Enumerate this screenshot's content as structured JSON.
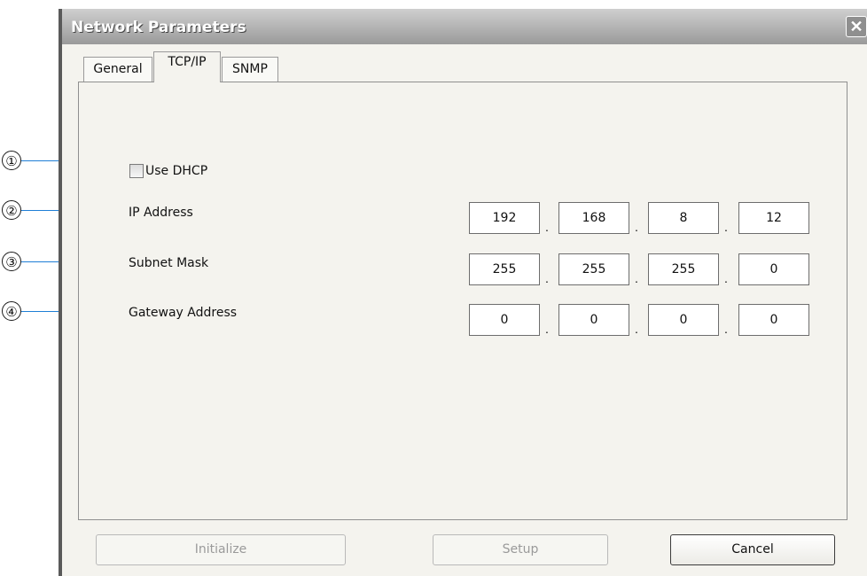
{
  "window": {
    "title": "Network Parameters",
    "close_glyph": "✕"
  },
  "tabs": [
    {
      "label": "General",
      "active": false
    },
    {
      "label": "TCP/IP",
      "active": true
    },
    {
      "label": "SNMP",
      "active": false
    }
  ],
  "callouts": [
    "①",
    "②",
    "③",
    "④"
  ],
  "tcpip": {
    "dhcp": {
      "label": "Use DHCP",
      "checked": false
    },
    "ip": {
      "label": "IP Address",
      "octets": [
        "192",
        "168",
        "8",
        "12"
      ]
    },
    "subnet": {
      "label": "Subnet Mask",
      "octets": [
        "255",
        "255",
        "255",
        "0"
      ]
    },
    "gateway": {
      "label": "Gateway Address",
      "octets": [
        "0",
        "0",
        "0",
        "0"
      ]
    }
  },
  "buttons": {
    "initialize": {
      "label": "Initialize",
      "enabled": false
    },
    "setup": {
      "label": "Setup",
      "enabled": false
    },
    "cancel": {
      "label": "Cancel",
      "enabled": true
    }
  },
  "colors": {
    "leader_line": "#1f7fd6",
    "titlebar": "#9a9a9a"
  }
}
